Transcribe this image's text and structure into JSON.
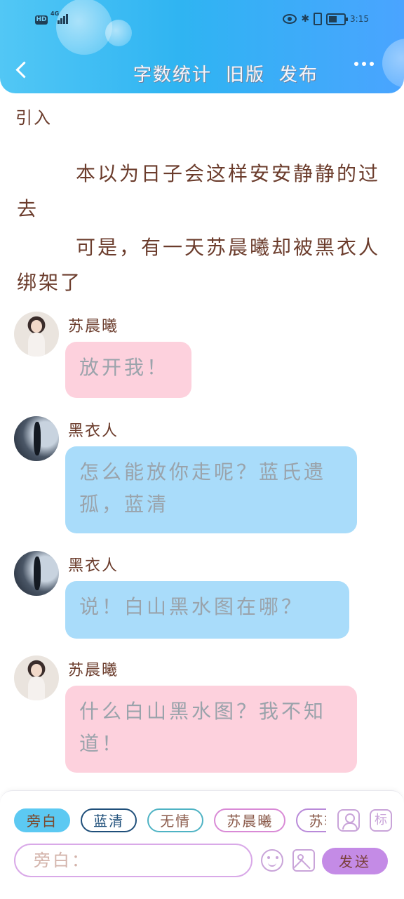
{
  "header": {
    "actions": [
      {
        "label": "字数统计"
      },
      {
        "label": "旧版"
      },
      {
        "label": "发布"
      }
    ]
  },
  "status_bar": {
    "hd": "HD",
    "network": "4G",
    "time": "3:15"
  },
  "story": {
    "intro_label": "引入",
    "narration": [
      "本以为日子会这样安安静静的过去",
      "可是，有一天苏晨曦却被黑衣人绑架了"
    ],
    "messages": [
      {
        "speaker": "苏晨曦",
        "text": "放开我！",
        "style": "pink"
      },
      {
        "speaker": "黑衣人",
        "text": "怎么能放你走呢？蓝氏遗孤，蓝清",
        "style": "blue"
      },
      {
        "speaker": "黑衣人",
        "text": "说！白山黑水图在哪？",
        "style": "blue"
      },
      {
        "speaker": "苏晨曦",
        "text": "什么白山黑水图？我不知道！",
        "style": "pink"
      }
    ]
  },
  "toolbar": {
    "roles": [
      {
        "label": "旁白",
        "color": "#5cc9f2"
      },
      {
        "label": "蓝清",
        "color": "#1f4f7a"
      },
      {
        "label": "无情",
        "color": "#4fb3c4"
      },
      {
        "label": "苏晨曦",
        "color": "#d98ad6"
      },
      {
        "label": "苏轩",
        "color": "#b98ad9"
      }
    ],
    "mark_label": "标",
    "input_placeholder": "旁白：",
    "send_label": "发送"
  }
}
